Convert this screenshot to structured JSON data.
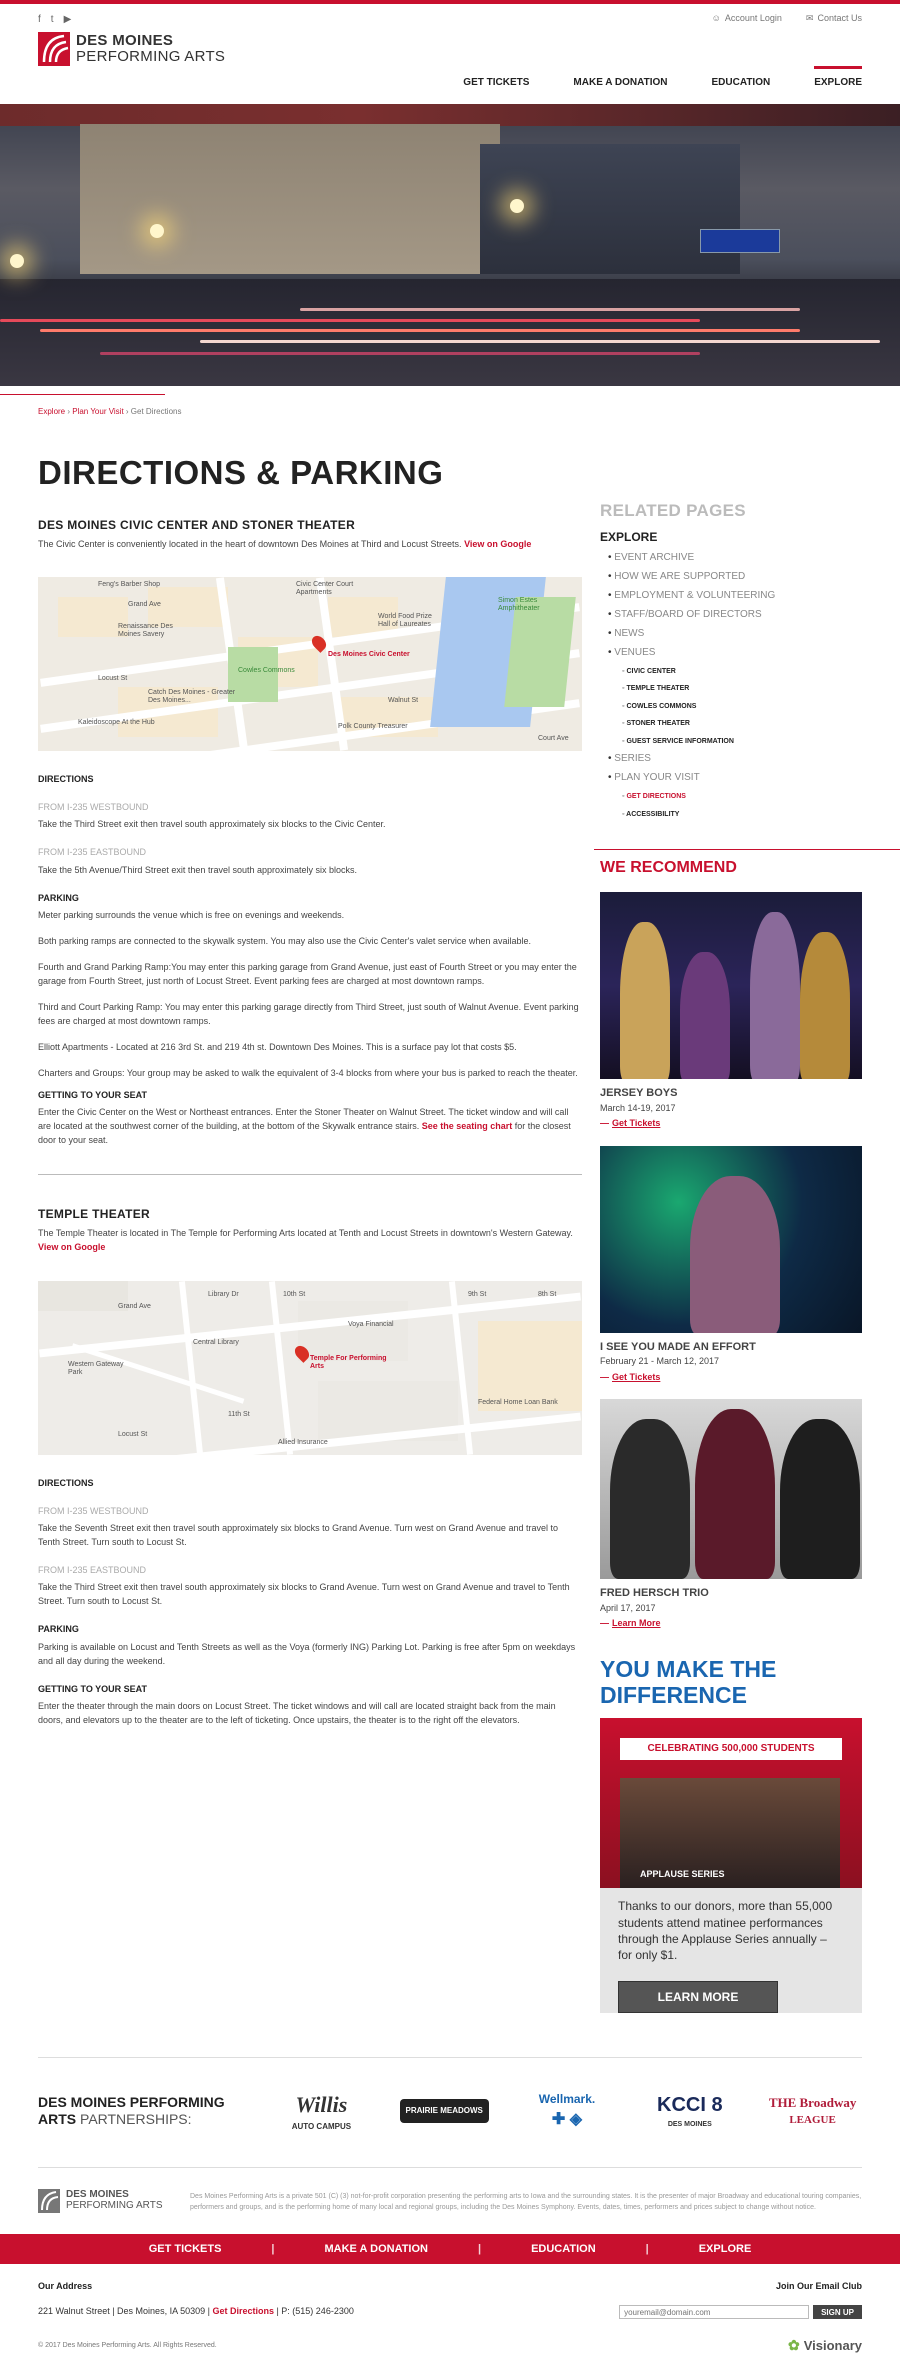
{
  "util": {
    "social": [
      "f",
      "t",
      "▶"
    ],
    "account_login": "Account Login",
    "contact_us": "Contact Us"
  },
  "logo": {
    "line1": "DES MOINES",
    "line2": "PERFORMING ARTS"
  },
  "nav": [
    "GET TICKETS",
    "MAKE A DONATION",
    "EDUCATION",
    "EXPLORE"
  ],
  "breadcrumb": {
    "explore": "Explore",
    "plan": "Plan Your Visit",
    "current": "Get Directions",
    "sep": " › "
  },
  "page_title": "DIRECTIONS & PARKING",
  "civic": {
    "heading": "DES MOINES CIVIC CENTER AND STONER THEATER",
    "intro": "The Civic Center is conveniently located in the heart of downtown Des Moines at Third and Locust Streets.",
    "google": "View on Google",
    "map": {
      "labels": [
        "Feng's Barber Shop",
        "Civic Center Court Apartments",
        "World Food Prize Hall of Laureates",
        "Simon Estes Amphitheater",
        "Renaissance Des Moines Savery",
        "Des Moines Civic Center",
        "Cowles Commons",
        "Catch Des Moines - Greater Des Moines...",
        "Kaleidoscope At the Hub",
        "Polk County Treasurer",
        "Grand Ave",
        "Locust St",
        "Walnut St",
        "Court Ave"
      ]
    },
    "directions_h": "DIRECTIONS",
    "west_h": "FROM I-235 WESTBOUND",
    "west": "Take the Third Street exit then travel south approximately six blocks to the Civic Center.",
    "east_h": "FROM I-235 EASTBOUND",
    "east": "Take the 5th Avenue/Third Street exit then travel south approximately six blocks.",
    "parking_h": "PARKING",
    "parking": [
      "Meter parking surrounds the venue which is free on evenings and weekends.",
      "Both parking ramps are connected to the skywalk system. You may also use the Civic Center's valet service when available.",
      "Fourth and Grand Parking Ramp:You may enter this parking garage from Grand Avenue, just east of Fourth Street or you may enter the garage from Fourth Street, just north of Locust Street. Event parking fees are charged at most downtown ramps.",
      "Third and Court Parking Ramp: You may enter this parking garage directly from Third Street, just south of Walnut Avenue. Event parking fees are charged at most downtown ramps.",
      "Elliott Apartments - Located at 216 3rd St. and  219 4th st. Downtown Des Moines. This is a surface pay lot that costs $5.",
      "Charters and Groups:  Your group may be asked to walk the equivalent of 3-4 blocks from where your bus is parked to reach the theater."
    ],
    "seat_h": "GETTING TO YOUR SEAT",
    "seat_a": "Enter the Civic Center on the West or Northeast entrances. Enter the Stoner Theater on Walnut Street. The ticket window and will call are located at the southwest corner of the building, at the bottom of the Skywalk entrance stairs.",
    "seat_link": "See the seating chart",
    "seat_b": " for the closest door to your seat."
  },
  "temple": {
    "heading": "TEMPLE THEATER",
    "intro": "The Temple Theater is located in The Temple for Performing Arts located at Tenth and Locust Streets in downtown's Western Gateway.",
    "google": "View on Google",
    "map": {
      "labels": [
        "Library Dr",
        "Grand Ave",
        "Central Library",
        "Temple For Performing Arts",
        "Voya Financial",
        "Federal Home Loan Bank",
        "Allied Insurance",
        "Locust St",
        "Western Gateway Park",
        "10th St",
        "11th St",
        "9th St",
        "8th St"
      ]
    },
    "directions_h": "DIRECTIONS",
    "west_h": "FROM I-235 WESTBOUND",
    "west": "Take the Seventh Street exit then travel south approximately six blocks to Grand Avenue. Turn west on Grand Avenue and travel to Tenth Street. Turn south to Locust St.",
    "east_h": "FROM I-235 EASTBOUND",
    "east": "Take the Third Street exit then travel south approximately six blocks to Grand Avenue. Turn west on Grand Avenue and travel to Tenth Street. Turn south to Locust St.",
    "parking_h": "PARKING",
    "parking": "Parking is available on Locust and Tenth Streets as well as the Voya (formerly ING) Parking Lot. Parking is free after 5pm on weekdays and all day during the weekend.",
    "seat_h": "GETTING TO YOUR SEAT",
    "seat": "Enter the theater through the main doors on Locust Street. The ticket windows and will call are located straight back from the main doors, and elevators up to the theater are to the left of ticketing. Once upstairs, the theater is to the right off the elevators."
  },
  "sidebar": {
    "related": "RELATED PAGES",
    "explore": "EXPLORE",
    "items": [
      "EVENT ARCHIVE",
      "HOW WE ARE SUPPORTED",
      "EMPLOYMENT & VOLUNTEERING",
      "STAFF/BOARD OF DIRECTORS",
      "NEWS",
      "VENUES"
    ],
    "venues": [
      "CIVIC CENTER",
      "TEMPLE THEATER",
      "COWLES COMMONS",
      "STONER THEATER",
      "GUEST SERVICE INFORMATION"
    ],
    "items2": [
      "SERIES",
      "PLAN YOUR VISIT"
    ],
    "plan": [
      "GET DIRECTIONS",
      "ACCESSIBILITY"
    ],
    "we_recommend": "WE RECOMMEND",
    "cards": [
      {
        "title": "JERSEY BOYS",
        "date": "March 14-19, 2017",
        "cta": "Get Tickets"
      },
      {
        "title": "I SEE YOU MADE AN EFFORT",
        "date": "February 21 - March 12, 2017",
        "cta": "Get Tickets"
      },
      {
        "title": "FRED HERSCH TRIO",
        "date": "April 17, 2017",
        "cta": "Learn More"
      }
    ],
    "you_make": "YOU MAKE THE DIFFERENCE",
    "banner": "CELEBRATING 500,000 STUDENTS",
    "applause": "APPLAUSE SERIES",
    "give_text": "Thanks to our donors, more than 55,000 students attend matinee performances through the Applause Series annually – for only $1.",
    "learn_more": "LEARN MORE"
  },
  "partners": {
    "head1": "DES MOINES PERFORMING",
    "head2": "ARTS",
    "head3": " PARTNERSHIPS:",
    "logos": [
      {
        "a": "Willis",
        "b": "AUTO CAMPUS"
      },
      {
        "a": "PRAIRIE MEADOWS",
        "b": ""
      },
      {
        "a": "Wellmark.",
        "b": ""
      },
      {
        "a": "KCCI 8",
        "b": "DES MOINES"
      },
      {
        "a": "THE Broadway",
        "b": "LEAGUE"
      }
    ]
  },
  "footer": {
    "blurb": "Des Moines Performing Arts is a private 501 (C) (3) not-for-profit corporation presenting the performing arts to Iowa and the surrounding states. It is the presenter of major Broadway and educational touring companies, performers and groups, and is the performing home of many local and regional groups, including the Des Moines Symphony. Events, dates, times, performers and prices subject to change without notice.",
    "nav": [
      "GET TICKETS",
      "MAKE A DONATION",
      "EDUCATION",
      "EXPLORE"
    ],
    "address_h": "Our Address",
    "address": "221 Walnut Street | Des Moines, IA 50309 | ",
    "get_dir": "Get Directions",
    "phone": " | P: (515) 246-2300",
    "email_h": "Join Our Email Club",
    "email_ph": "youremail@domain.com",
    "signup": "SIGN UP",
    "copyright": "© 2017 Des Moines Performing Arts. All Rights Reserved.",
    "visionary": "Visionary"
  }
}
